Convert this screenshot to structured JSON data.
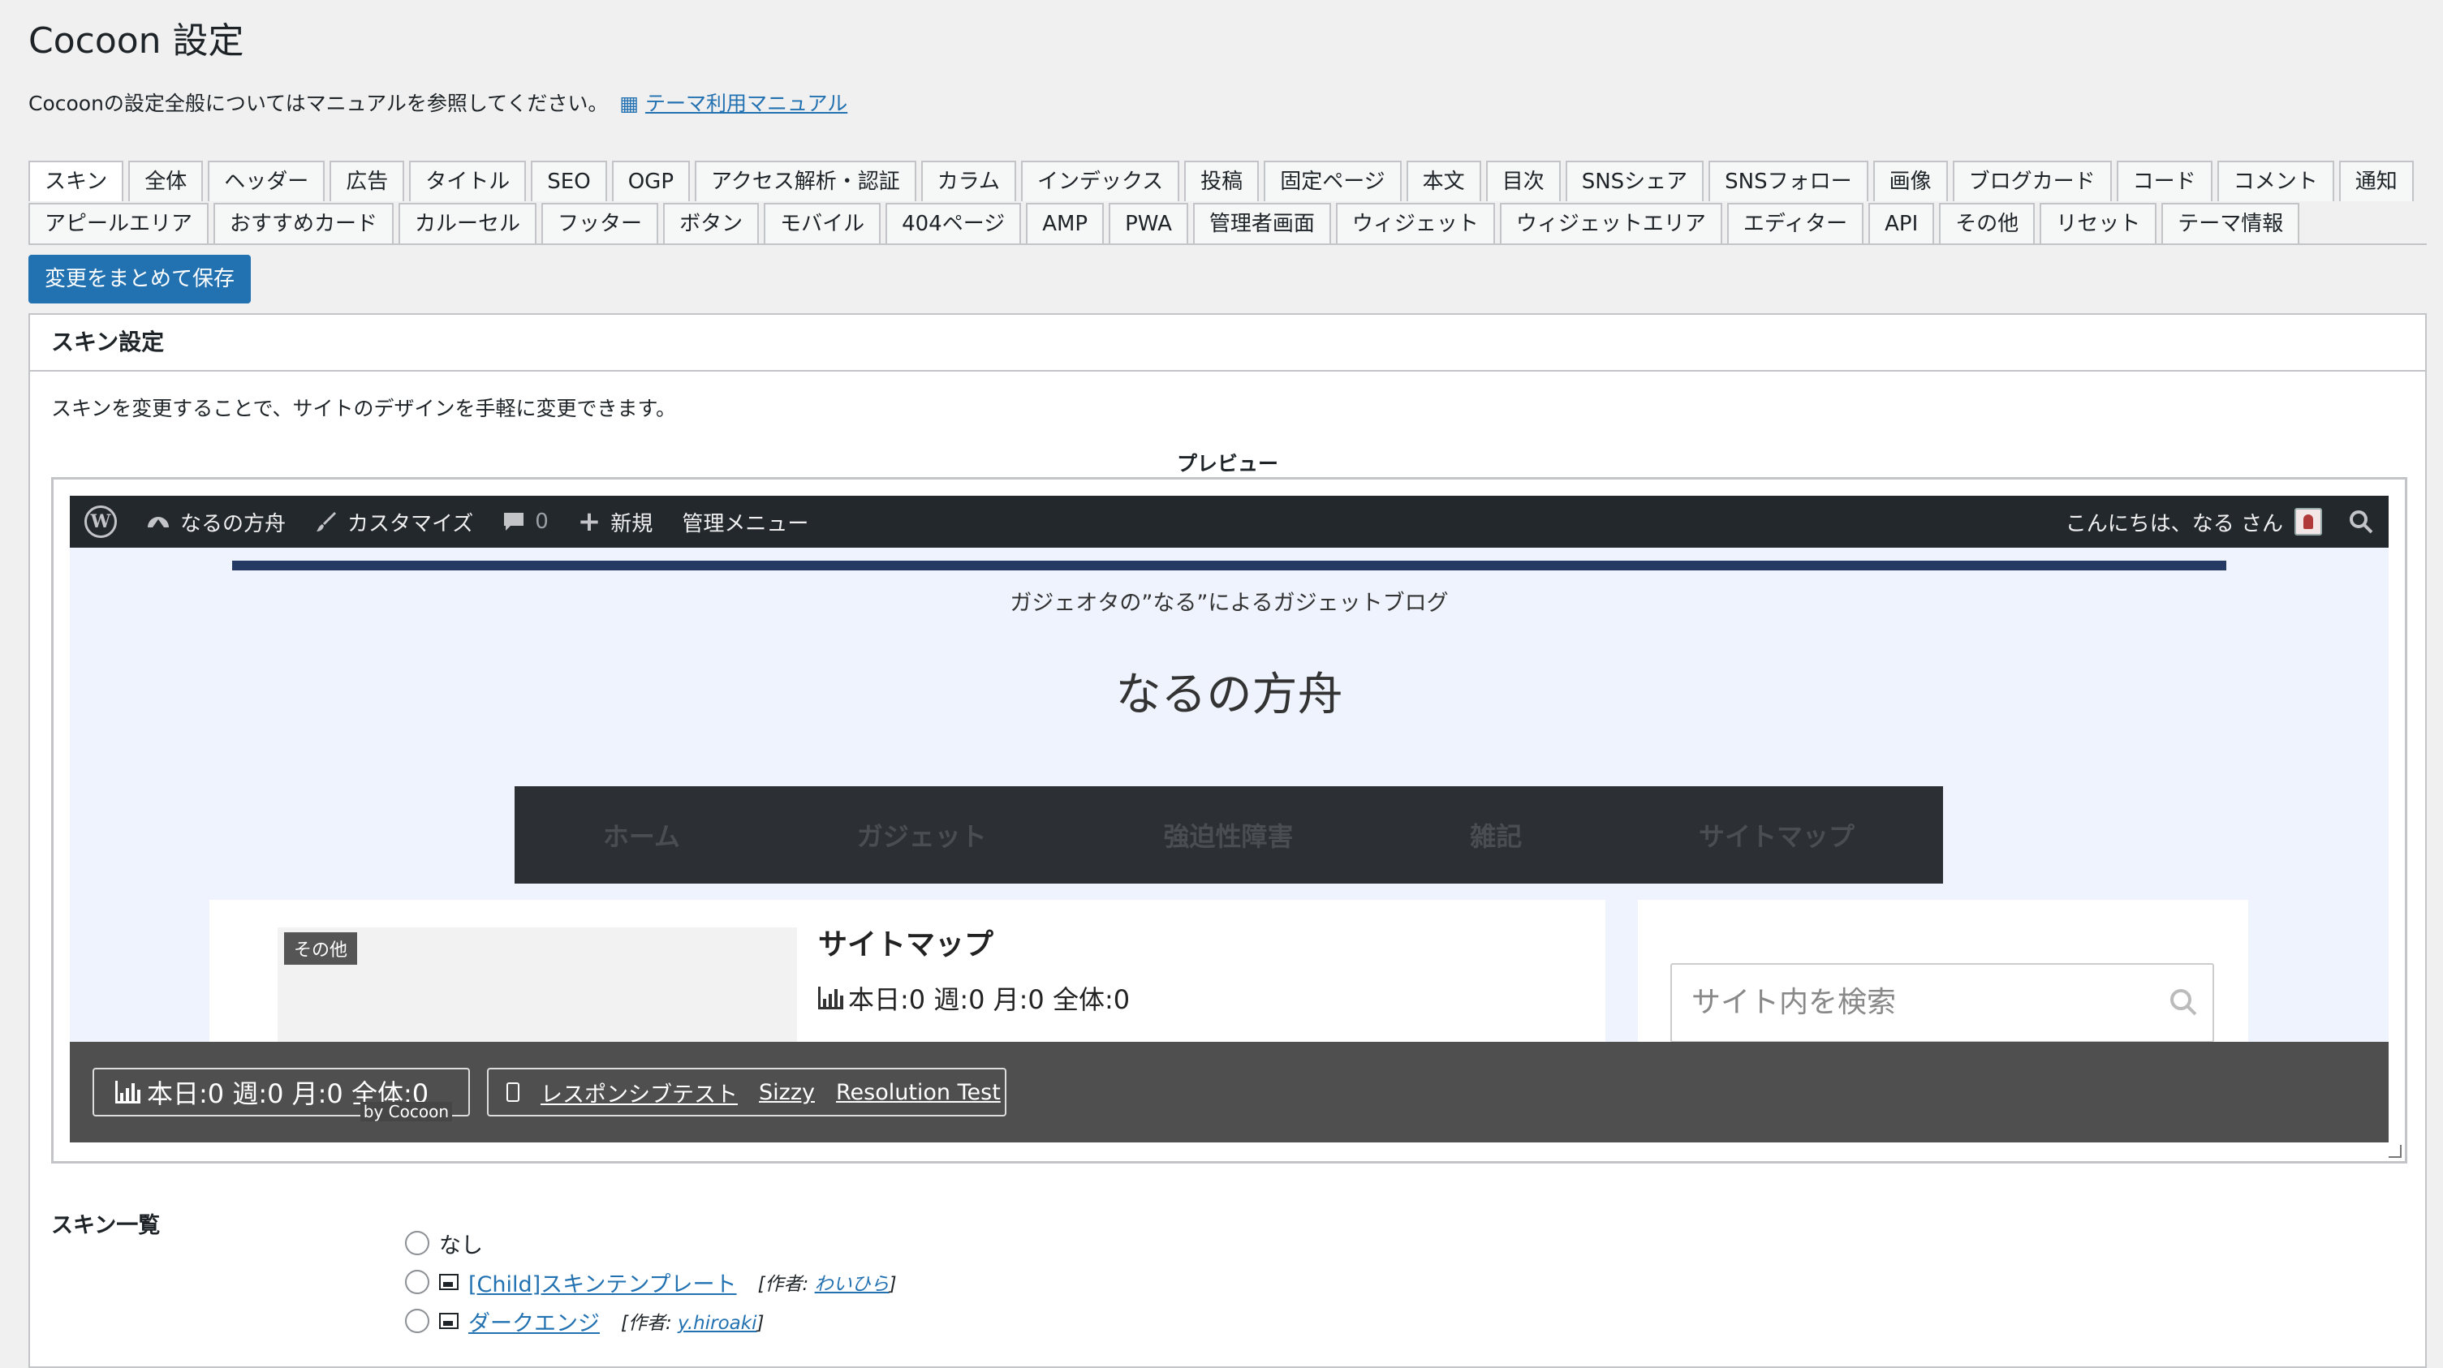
{
  "page": {
    "title": "Cocoon 設定",
    "intro_text": "Cocoonの設定全般についてはマニュアルを参照してください。",
    "manual_link": "テーマ利用マニュアル"
  },
  "tabs_row1": [
    "スキン",
    "全体",
    "ヘッダー",
    "広告",
    "タイトル",
    "SEO",
    "OGP",
    "アクセス解析・認証",
    "カラム",
    "インデックス",
    "投稿",
    "固定ページ",
    "本文",
    "目次",
    "SNSシェア",
    "SNSフォロー",
    "画像",
    "ブログカード",
    "コード",
    "コメント",
    "通知"
  ],
  "tabs_row2": [
    "アピールエリア",
    "おすすめカード",
    "カルーセル",
    "フッター",
    "ボタン",
    "モバイル",
    "404ページ",
    "AMP",
    "PWA",
    "管理者画面",
    "ウィジェット",
    "ウィジェットエリア",
    "エディター",
    "API",
    "その他",
    "リセット",
    "テーマ情報"
  ],
  "active_tab": "スキン",
  "save_button": "変更をまとめて保存",
  "panel": {
    "heading": "スキン設定",
    "description": "スキンを変更することで、サイトのデザインを手軽に変更できます。",
    "preview_label": "プレビュー"
  },
  "preview": {
    "adminbar": {
      "site_name": "なるの方舟",
      "customize": "カスタマイズ",
      "comments_count": "0",
      "new": "新規",
      "admin_menu": "管理メニュー",
      "greeting": "こんにちは、なる さん"
    },
    "tagline": "ガジェオタの”なる”によるガジェットブログ",
    "site_title": "なるの方舟",
    "nav": [
      "ホーム",
      "ガジェット",
      "強迫性障害",
      "雑記",
      "サイトマップ"
    ],
    "category_badge": "その他",
    "post_title": "サイトマップ",
    "post_stats": "本日:0 週:0 月:0 全体:0",
    "search_placeholder": "サイト内を検索",
    "footer_stats": "本日:0 週:0 月:0 全体:0",
    "by_cocoon": "by Cocoon",
    "footer_links": [
      "レスポンシブテスト",
      "Sizzy",
      "Resolution Test"
    ]
  },
  "skin_list": {
    "label": "スキン一覧",
    "items": [
      {
        "name": "なし"
      },
      {
        "name": "[Child]スキンテンプレート",
        "author_label": "[作者: ",
        "author": "わいひら",
        "author_close": "]"
      },
      {
        "name": "ダークエンジ",
        "author_label": "[作者: ",
        "author": "y.hiroaki",
        "author_close": "]"
      }
    ]
  }
}
